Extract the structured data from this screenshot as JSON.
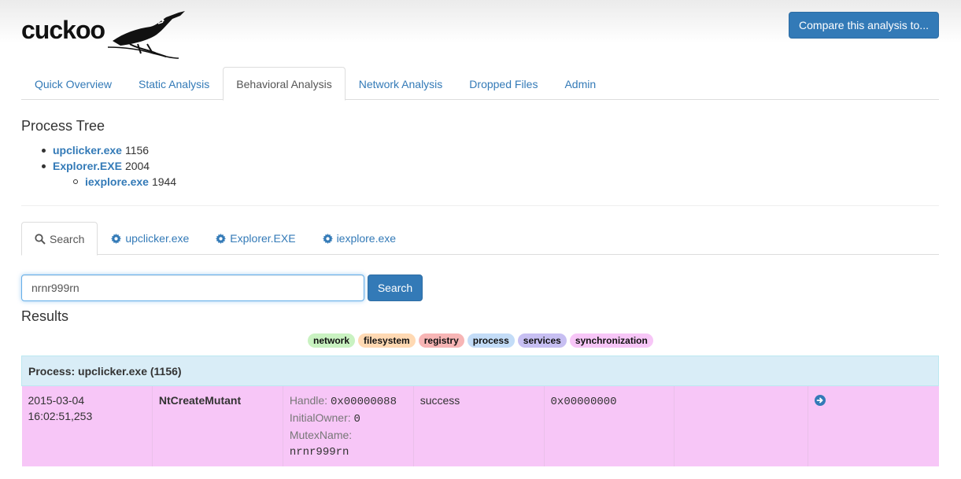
{
  "header": {
    "logo_text": "cuckoo",
    "compare_label": "Compare this analysis to..."
  },
  "main_tabs": [
    {
      "label": "Quick Overview"
    },
    {
      "label": "Static Analysis"
    },
    {
      "label": "Behavioral Analysis",
      "active": true
    },
    {
      "label": "Network Analysis"
    },
    {
      "label": "Dropped Files"
    },
    {
      "label": "Admin"
    }
  ],
  "process_tree": {
    "title": "Process Tree",
    "items": [
      {
        "name": "upclicker.exe",
        "pid": "1156"
      },
      {
        "name": "Explorer.EXE",
        "pid": "2004"
      },
      {
        "name": "iexplore.exe",
        "pid": "1944"
      }
    ]
  },
  "process_tabs": [
    {
      "label": "Search",
      "icon": "search-icon"
    },
    {
      "label": "upclicker.exe",
      "icon": "gear-icon"
    },
    {
      "label": "Explorer.EXE",
      "icon": "gear-icon"
    },
    {
      "label": "iexplore.exe",
      "icon": "gear-icon"
    }
  ],
  "search": {
    "value": "nrnr999rn",
    "button_label": "Search"
  },
  "results": {
    "title": "Results",
    "categories": [
      {
        "label": "network",
        "color": "#c9f2c1"
      },
      {
        "label": "filesystem",
        "color": "#ffd9b3"
      },
      {
        "label": "registry",
        "color": "#f7b5b5"
      },
      {
        "label": "process",
        "color": "#c3dcf7"
      },
      {
        "label": "services",
        "color": "#c7bff2"
      },
      {
        "label": "synchronization",
        "color": "#f7c6f7"
      }
    ],
    "process_header": "Process: upclicker.exe (1156)",
    "calls": [
      {
        "date": "2015-03-04",
        "time": "16:02:51,253",
        "api": "NtCreateMutant",
        "args": [
          {
            "name": "Handle:",
            "value": "0x00000088"
          },
          {
            "name": "InitialOwner:",
            "value": "0"
          },
          {
            "name": "MutexName:",
            "value": "nrnr999rn"
          }
        ],
        "status": "success",
        "return": "0x00000000",
        "category": "synchronization"
      }
    ]
  },
  "colors": {
    "link": "#337ab7",
    "primary_button": "#337ab7",
    "process_header_bg": "#d9edf7",
    "synchronization_row_bg": "#f7c6f7"
  }
}
